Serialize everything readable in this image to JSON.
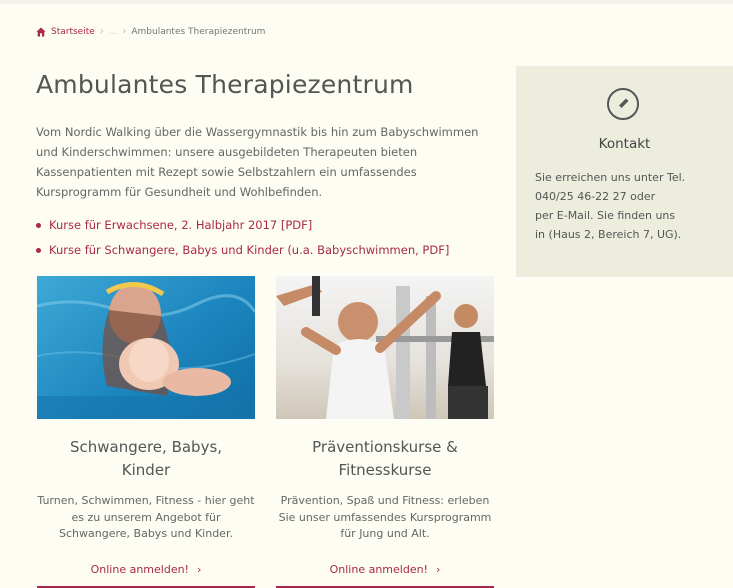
{
  "breadcrumb": {
    "home": "Startseite",
    "ellipsis": "...",
    "current": "Ambulantes Therapiezentrum"
  },
  "page": {
    "title": "Ambulantes Therapiezentrum",
    "intro": "Vom Nordic Walking über die Wassergymnastik bis hin zum Babyschwimmen und Kinderschwimmen: unsere ausgebildeten Therapeuten bieten Kassenpatienten mit Rezept sowie Selbstzahlern ein umfassendes Kursprogramm für Gesundheit und Wohlbefinden.",
    "links": [
      "Kurse für Erwachsene, 2. Halbjahr 2017 [PDF]",
      "Kurse für Schwangere, Babys und Kinder (u.a. Babyschwimmen, PDF]"
    ]
  },
  "cards": [
    {
      "title_line1": "Schwangere, Babys,",
      "title_line2": "Kinder",
      "text": "Turnen, Schwimmen, Fitness - hier geht es zu unserem Angebot für Schwangere, Babys und Kinder.",
      "cta": "Online anmelden!"
    },
    {
      "title_line1": "Präventionskurse &",
      "title_line2": "Fitnesskurse",
      "text": "Prävention, Spaß und Fitness: erleben Sie unser umfassendes Kursprogramm für Jung und Alt.",
      "cta": "Online anmelden!"
    }
  ],
  "contact": {
    "icon": "pencil-icon",
    "title": "Kontakt",
    "line1": "Sie erreichen uns unter Tel.",
    "line2": "040/25 46-22 27 oder",
    "line3": "per E-Mail. Sie finden uns",
    "line4": "in (Haus 2, Bereich 7, UG)."
  },
  "colors": {
    "accent": "#a9284b",
    "background": "#fdfdf3",
    "aside_background": "#ededde"
  }
}
